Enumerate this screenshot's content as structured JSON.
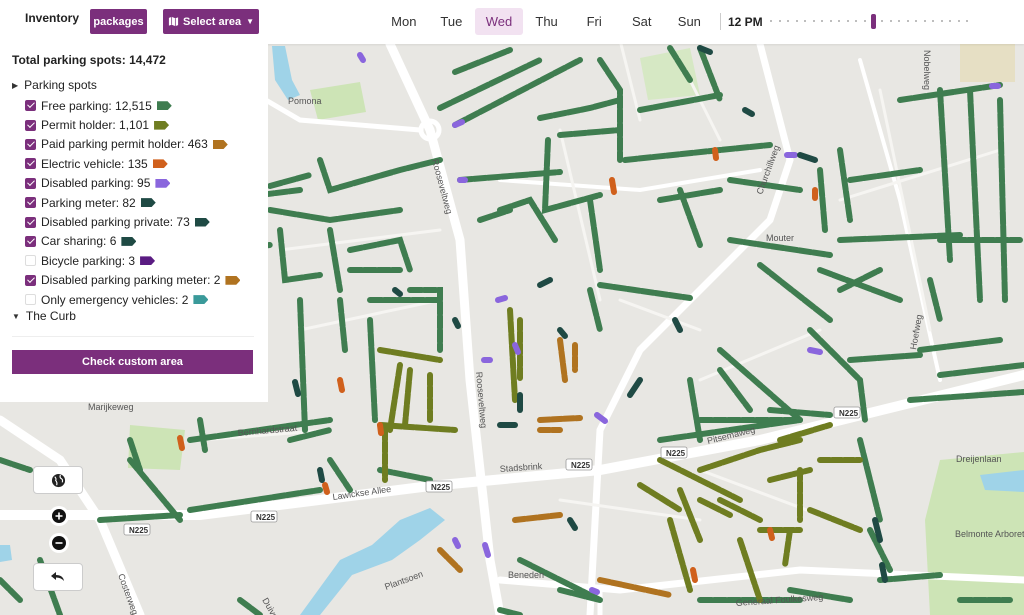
{
  "header": {
    "title": "Inventory",
    "packages_label": "packages",
    "select_area_label": "Select area",
    "days": [
      "Mon",
      "Tue",
      "Wed",
      "Thu",
      "Fri",
      "Sat",
      "Sun"
    ],
    "active_day": "Wed",
    "time_label": "12 PM",
    "time_slider": {
      "ticks": 24,
      "selected_index": 12
    }
  },
  "panel": {
    "total": "Total parking spots: 14,472",
    "parking_spots_heading": "Parking spots",
    "items": [
      {
        "label": "Free parking: 12,515",
        "checked": true,
        "color": "#3f7d50"
      },
      {
        "label": "Permit holder: 1,101",
        "checked": true,
        "color": "#6f7d21"
      },
      {
        "label": "Paid parking permit holder: 463",
        "checked": true,
        "color": "#b07320"
      },
      {
        "label": "Electric vehicle: 135",
        "checked": true,
        "color": "#d0601c"
      },
      {
        "label": "Disabled parking: 95",
        "checked": true,
        "color": "#8a66dd"
      },
      {
        "label": "Parking meter: 82",
        "checked": true,
        "color": "#1f4a44"
      },
      {
        "label": "Disabled parking private: 73",
        "checked": true,
        "color": "#1f4a44"
      },
      {
        "label": "Car sharing: 6",
        "checked": true,
        "color": "#1f4a44"
      },
      {
        "label": "Bicycle parking: 3",
        "checked": false,
        "color": "#5a1c82"
      },
      {
        "label": "Disabled parking parking meter: 2",
        "checked": true,
        "color": "#b07320"
      },
      {
        "label": "Only emergency vehicles: 2",
        "checked": false,
        "color": "#3a9a9a"
      }
    ],
    "curb_heading": "The Curb",
    "custom_area_button": "Check custom area"
  },
  "map": {
    "labels": [
      "Pomona",
      "Roosevel tweg",
      "Rooseveltweg",
      "Marijkeweg",
      "Bernhardstraat",
      "Lawickse Allee",
      "Stadsbrink",
      "Pitsemaweg",
      "Churchillweg",
      "Mouter",
      "Dreijenlaan",
      "Belmonte Arboretum Wageningen",
      "Plantsoen",
      "Costerweg",
      "Generaal Foulkesweg",
      "Beneden",
      "Nobelweg",
      "Hoefweg",
      "Duivendaal"
    ],
    "road_shields": [
      "N225",
      "N225",
      "N225",
      "N225",
      "N225",
      "N225"
    ],
    "colors": {
      "free": "#3f7d50",
      "permit": "#6f7d21",
      "paid_permit": "#b07320",
      "electric": "#d0601c",
      "disabled": "#8a66dd",
      "meter": "#1f4a44",
      "park_green": "#cfe6b8",
      "water": "#9fd3e8"
    }
  }
}
